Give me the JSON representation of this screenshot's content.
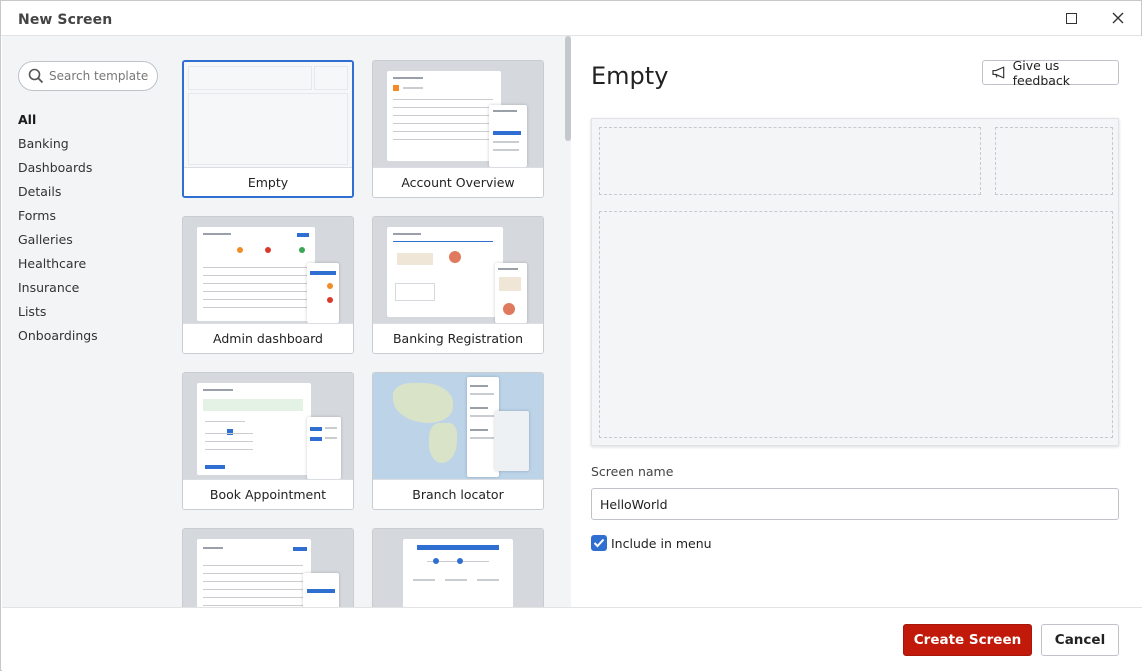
{
  "window": {
    "title": "New Screen"
  },
  "search": {
    "placeholder": "Search template"
  },
  "categories": [
    "All",
    "Banking",
    "Dashboards",
    "Details",
    "Forms",
    "Galleries",
    "Healthcare",
    "Insurance",
    "Lists",
    "Onboardings"
  ],
  "active_category": "All",
  "templates": [
    {
      "label": "Empty",
      "selected": true
    },
    {
      "label": "Account Overview",
      "selected": false
    },
    {
      "label": "Admin dashboard",
      "selected": false
    },
    {
      "label": "Banking Registration",
      "selected": false
    },
    {
      "label": "Book Appointment",
      "selected": false
    },
    {
      "label": "Branch locator",
      "selected": false
    }
  ],
  "preview": {
    "title": "Empty",
    "feedback_label": "Give us feedback"
  },
  "form": {
    "screen_name_label": "Screen name",
    "screen_name_value": "HelloWorld",
    "include_in_menu_label": "Include in menu",
    "include_in_menu_checked": true
  },
  "footer": {
    "create_label": "Create Screen",
    "cancel_label": "Cancel"
  },
  "colors": {
    "accent": "#2f6fd1",
    "primary_button": "#c21a0a"
  }
}
